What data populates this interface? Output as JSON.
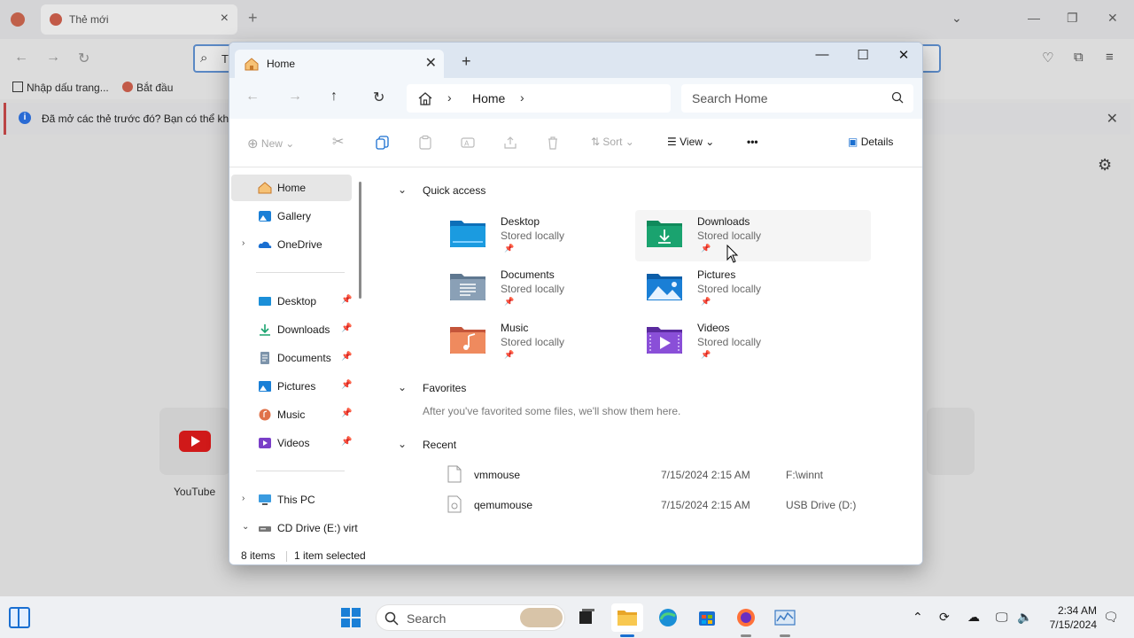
{
  "firefox": {
    "tab_title": "Thẻ mới",
    "urlbar_text": "T",
    "bookmarks": [
      "Nhập dấu trang...",
      "Bắt đầu"
    ],
    "notification": "Đã mở các thẻ trước đó? Bạn có thể khôi",
    "shortcut_label": "YouTube"
  },
  "explorer": {
    "tab_title": "Home",
    "breadcrumb": "Home",
    "search_placeholder": "Search Home",
    "toolbar": {
      "new_label": "New",
      "sort_label": "Sort",
      "view_label": "View",
      "more_label": "•••",
      "details_label": "Details"
    },
    "sidebar": {
      "top": [
        {
          "label": "Home",
          "selected": true
        },
        {
          "label": "Gallery"
        },
        {
          "label": "OneDrive",
          "expandable": true
        }
      ],
      "pinned": [
        "Desktop",
        "Downloads",
        "Documents",
        "Pictures",
        "Music",
        "Videos"
      ],
      "bottom": [
        {
          "label": "This PC",
          "expandable": true
        },
        {
          "label": "CD Drive (E:) virt",
          "expanded": true
        }
      ]
    },
    "sections": {
      "quick_access": "Quick access",
      "favorites": "Favorites",
      "recent": "Recent"
    },
    "quick_access": [
      {
        "name": "Desktop",
        "sub": "Stored locally",
        "color": "#1b8fd8"
      },
      {
        "name": "Downloads",
        "sub": "Stored locally",
        "color": "#1aa36f"
      },
      {
        "name": "Documents",
        "sub": "Stored locally",
        "color": "#7d94ab"
      },
      {
        "name": "Pictures",
        "sub": "Stored locally",
        "color": "#1a7fd6"
      },
      {
        "name": "Music",
        "sub": "Stored locally",
        "color": "#e0724a"
      },
      {
        "name": "Videos",
        "sub": "Stored locally",
        "color": "#7a3fc8"
      }
    ],
    "favorites_hint": "After you've favorited some files, we'll show them here.",
    "recent": [
      {
        "name": "vmmouse",
        "date": "7/15/2024 2:15 AM",
        "location": "F:\\winnt"
      },
      {
        "name": "qemumouse",
        "date": "7/15/2024 2:15 AM",
        "location": "USB Drive (D:)"
      }
    ],
    "status": {
      "items": "8 items",
      "selected": "1 item selected"
    }
  },
  "taskbar": {
    "search_label": "Search",
    "time": "2:34 AM",
    "date": "7/15/2024"
  }
}
